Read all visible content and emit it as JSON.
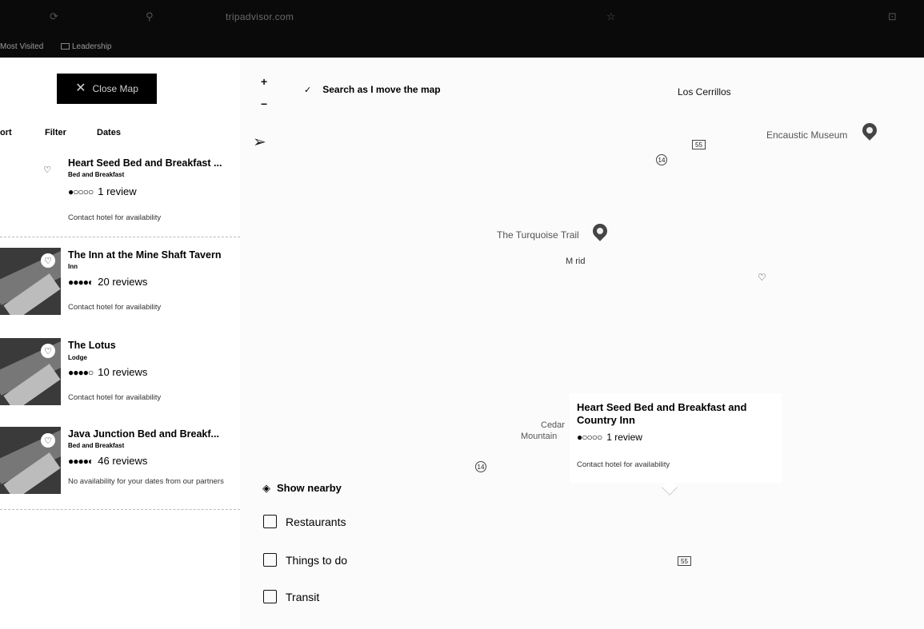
{
  "browser": {
    "url": "tripadvisor.com",
    "bookmarks": [
      "Most Visited",
      "Leadership"
    ]
  },
  "left_panel": {
    "close_map_label": "Close Map",
    "filters": [
      {
        "label": "ort"
      },
      {
        "label": "Filter"
      },
      {
        "label": "Dates"
      }
    ],
    "listings": [
      {
        "title": "Heart Seed Bed and Breakfast ...",
        "type": "Bed and Breakfast",
        "bubbles": "●○○○○",
        "reviews": "1 review",
        "availability": "Contact hotel for availability",
        "has_image": false
      },
      {
        "title": "The Inn at the Mine Shaft Tavern",
        "type": "Inn",
        "bubbles": "●●●●◐",
        "reviews": "20 reviews",
        "availability": "Contact hotel for availability",
        "has_image": true
      },
      {
        "title": "The Lotus",
        "type": "Lodge",
        "bubbles": "●●●●○",
        "reviews": "10 reviews",
        "availability": "Contact hotel for availability",
        "has_image": true
      },
      {
        "title": "Java Junction Bed and Breakf...",
        "type": "Bed and Breakfast",
        "bubbles": "●●●●◐",
        "reviews": "46 reviews",
        "availability": "No availability for your dates from our partners",
        "has_image": true
      }
    ]
  },
  "map": {
    "zoom_in": "+",
    "zoom_out": "−",
    "search_as_move": "Search as I move the map",
    "labels": {
      "los_cerrillos": "Los Cerrillos",
      "encaustic_museum": "Encaustic Museum",
      "turquoise_trail": "The Turquoise Trail",
      "madrid": "M  rid",
      "cedar": "Cedar",
      "mountain": "Mountain"
    },
    "roads": {
      "r14a": "14",
      "r14b": "14",
      "r55a": "55",
      "r55b": "55"
    },
    "popup": {
      "title": "Heart Seed Bed and Breakfast and Country Inn",
      "bubbles": "●○○○○",
      "reviews": "1 review",
      "availability": "Contact hotel for availability"
    },
    "nearby": {
      "heading": "Show nearby",
      "options": [
        "Restaurants",
        "Things to do",
        "Transit"
      ]
    }
  }
}
